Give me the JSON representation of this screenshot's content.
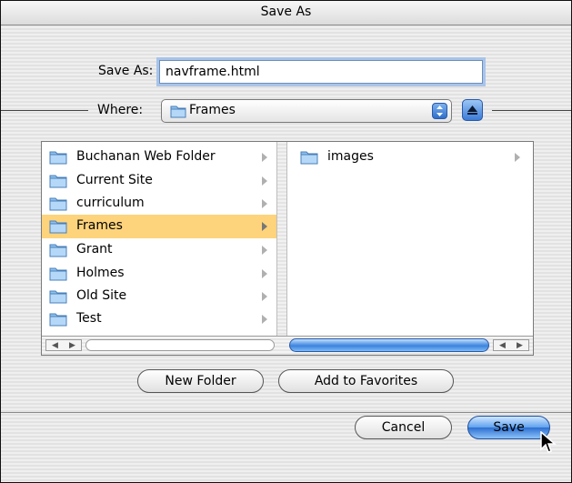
{
  "dialog": {
    "title": "Save As"
  },
  "save_as": {
    "label": "Save As:",
    "value": "navframe.html"
  },
  "where": {
    "label": "Where:",
    "value": "Frames"
  },
  "columns": [
    {
      "items": [
        {
          "label": "Buchanan Web Folder",
          "selected": false
        },
        {
          "label": "Current Site",
          "selected": false
        },
        {
          "label": "curriculum",
          "selected": false
        },
        {
          "label": "Frames",
          "selected": true
        },
        {
          "label": "Grant",
          "selected": false
        },
        {
          "label": "Holmes",
          "selected": false
        },
        {
          "label": "Old Site",
          "selected": false
        },
        {
          "label": "Test",
          "selected": false
        }
      ]
    },
    {
      "items": [
        {
          "label": "images",
          "selected": false
        }
      ]
    }
  ],
  "buttons": {
    "new_folder": "New Folder",
    "add_to_favorites": "Add to Favorites",
    "cancel": "Cancel",
    "save": "Save"
  },
  "colors": {
    "selection": "#fdd37c",
    "accent_blue": "#3c83de",
    "folder_blue": "#8ec1f0"
  },
  "icons": [
    "folder-icon",
    "disclosure-arrow-icon",
    "popup-arrows-icon",
    "expand-arrow-icon",
    "mouse-cursor-icon"
  ]
}
